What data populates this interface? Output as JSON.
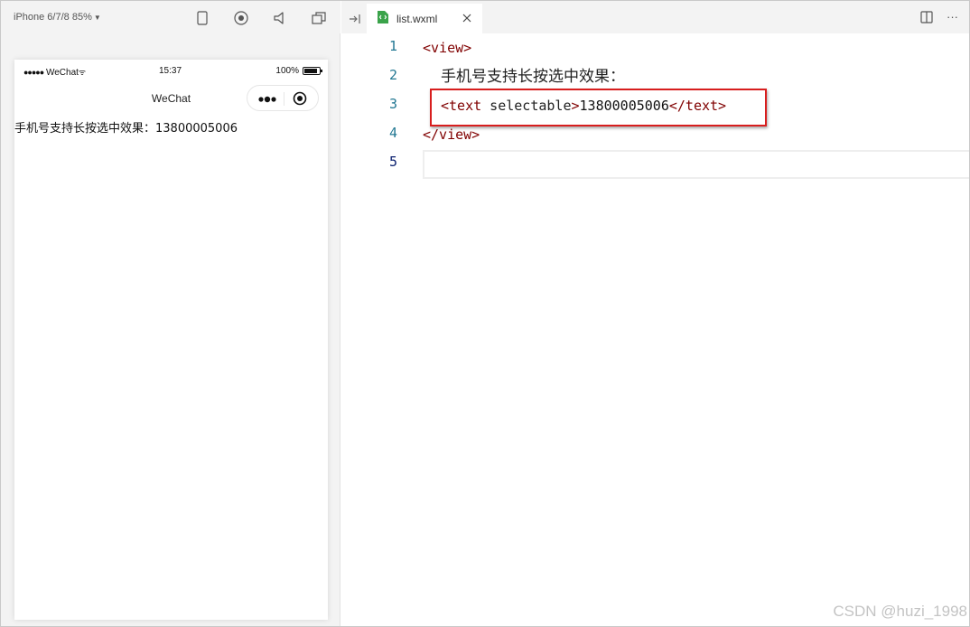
{
  "simulator": {
    "device_label": "iPhone 6/7/8 85%",
    "toolbar_icons": [
      "phone-icon",
      "record-icon",
      "volume-icon",
      "window-icon"
    ],
    "status_bar": {
      "carrier": "WeChat",
      "time": "15:37",
      "battery": "100%"
    },
    "nav_title": "WeChat",
    "page": {
      "label": "手机号支持长按选中效果：",
      "phone_number": "13800005006"
    }
  },
  "editor": {
    "tab": {
      "file_name": "list.wxml"
    },
    "lines": [
      {
        "number": "1",
        "tag_open": "<view>"
      },
      {
        "number": "2",
        "text": "手机号支持长按选中效果："
      },
      {
        "number": "3",
        "tag_open": "<text",
        "attribute": " selectable",
        "tag_gt": ">",
        "text": "13800005006",
        "tag_close": "</text>"
      },
      {
        "number": "4",
        "tag_close": "</view>"
      },
      {
        "number": "5"
      }
    ],
    "colors": {
      "tag": "#800000",
      "line_number": "#237893",
      "highlight_box": "#d81e1e"
    }
  },
  "watermark": "CSDN @huzi_1998"
}
